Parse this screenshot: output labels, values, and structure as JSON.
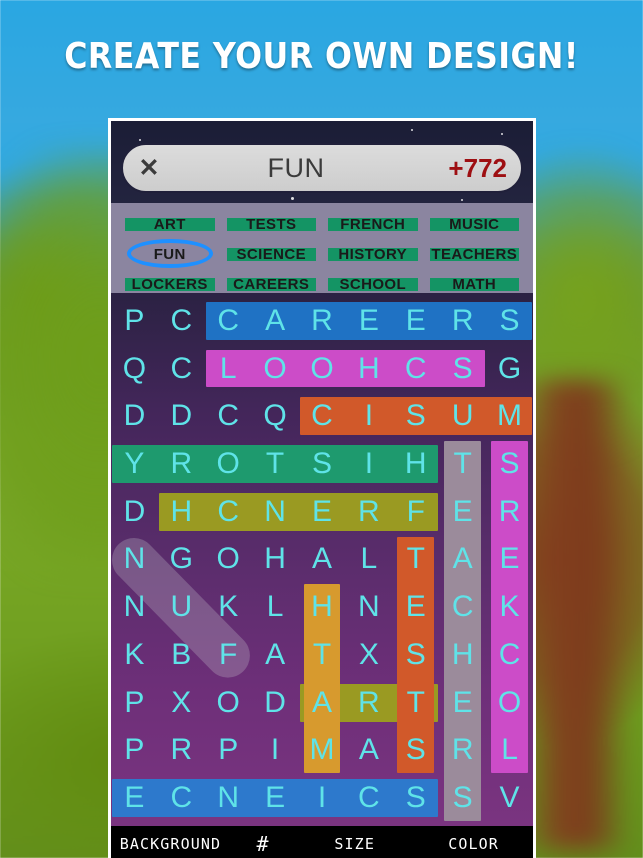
{
  "headline": "CREATE YOUR OWN DESIGN!",
  "header": {
    "close_icon": "close-x-icon",
    "close_label": "✕",
    "title": "FUN",
    "score": "+772",
    "score_color": "#9e0f12"
  },
  "word_list": {
    "rows": [
      [
        {
          "label": "ART",
          "found": true,
          "selected": false
        },
        {
          "label": "TESTS",
          "found": true,
          "selected": false
        },
        {
          "label": "FRENCH",
          "found": true,
          "selected": false
        },
        {
          "label": "MUSIC",
          "found": true,
          "selected": false
        }
      ],
      [
        {
          "label": "FUN",
          "found": false,
          "selected": true
        },
        {
          "label": "SCIENCE",
          "found": true,
          "selected": false
        },
        {
          "label": "HISTORY",
          "found": true,
          "selected": false
        },
        {
          "label": "TEACHERS",
          "found": true,
          "selected": false
        }
      ],
      [
        {
          "label": "LOCKERS",
          "found": true,
          "selected": false
        },
        {
          "label": "CAREERS",
          "found": true,
          "selected": false
        },
        {
          "label": "SCHOOL",
          "found": true,
          "selected": false
        },
        {
          "label": "MATH",
          "found": true,
          "selected": false
        }
      ]
    ],
    "strike_color": "#149464",
    "panel_color": "#8b85a0",
    "selection_ring_color": "#1e90ff"
  },
  "grid": {
    "cols": 9,
    "rows": 11,
    "letter_color": "#5fe3e8",
    "letters": [
      [
        "P",
        "C",
        "C",
        "A",
        "R",
        "E",
        "E",
        "R",
        "S"
      ],
      [
        "Q",
        "C",
        "L",
        "O",
        "O",
        "H",
        "C",
        "S",
        "G"
      ],
      [
        "D",
        "D",
        "C",
        "Q",
        "C",
        "I",
        "S",
        "U",
        "M"
      ],
      [
        "Y",
        "R",
        "O",
        "T",
        "S",
        "I",
        "H",
        "T",
        "S"
      ],
      [
        "D",
        "H",
        "C",
        "N",
        "E",
        "R",
        "F",
        "E",
        "R"
      ],
      [
        "N",
        "G",
        "O",
        "H",
        "A",
        "L",
        "T",
        "A",
        "E"
      ],
      [
        "N",
        "U",
        "K",
        "L",
        "H",
        "N",
        "E",
        "C",
        "K"
      ],
      [
        "K",
        "B",
        "F",
        "A",
        "T",
        "X",
        "S",
        "H",
        "C"
      ],
      [
        "P",
        "X",
        "O",
        "D",
        "A",
        "R",
        "T",
        "E",
        "O"
      ],
      [
        "P",
        "R",
        "P",
        "I",
        "M",
        "A",
        "S",
        "R",
        "L"
      ],
      [
        "E",
        "C",
        "N",
        "E",
        "I",
        "C",
        "S",
        "S",
        "V"
      ]
    ],
    "found_words": [
      {
        "word": "CAREERS",
        "color": "#1f72c4",
        "row": 0,
        "col": 2,
        "len": 7,
        "dir": "h"
      },
      {
        "word": "SCHOOL",
        "color": "#cc4cc8",
        "row": 1,
        "col": 2,
        "len": 6,
        "dir": "h"
      },
      {
        "word": "MUSIC",
        "color": "#d1592a",
        "row": 2,
        "col": 4,
        "len": 5,
        "dir": "h"
      },
      {
        "word": "HISTORY",
        "color": "#1e9a6e",
        "row": 3,
        "col": 0,
        "len": 7,
        "dir": "h"
      },
      {
        "word": "FRENCH",
        "color": "#9a9a22",
        "row": 4,
        "col": 1,
        "len": 6,
        "dir": "h"
      },
      {
        "word": "ART",
        "color": "#9a9a22",
        "row": 8,
        "col": 4,
        "len": 3,
        "dir": "h"
      },
      {
        "word": "SCIENCE",
        "color": "#2d79cc",
        "row": 10,
        "col": 0,
        "len": 7,
        "dir": "h"
      },
      {
        "word": "MATH",
        "color": "#d79a2e",
        "row": 6,
        "col": 4,
        "len": 4,
        "dir": "v"
      },
      {
        "word": "TESTS",
        "color": "#d1592a",
        "row": 5,
        "col": 6,
        "len": 5,
        "dir": "v"
      },
      {
        "word": "TEACHERS",
        "color": "#9b8b9b",
        "row": 3,
        "col": 7,
        "len": 8,
        "dir": "v"
      },
      {
        "word": "LOCKERS",
        "color": "#cc4cc8",
        "row": 3,
        "col": 8,
        "len": 7,
        "dir": "v"
      }
    ],
    "active_drag": {
      "from_row": 5,
      "from_col": 0,
      "to_row": 7,
      "to_col": 2,
      "color": "rgba(200,200,210,0.28)"
    }
  },
  "toolbar": {
    "background_label": "BACKGROUND",
    "grid_label": "#",
    "size_label": "SIZE",
    "color_label": "COLOR"
  }
}
